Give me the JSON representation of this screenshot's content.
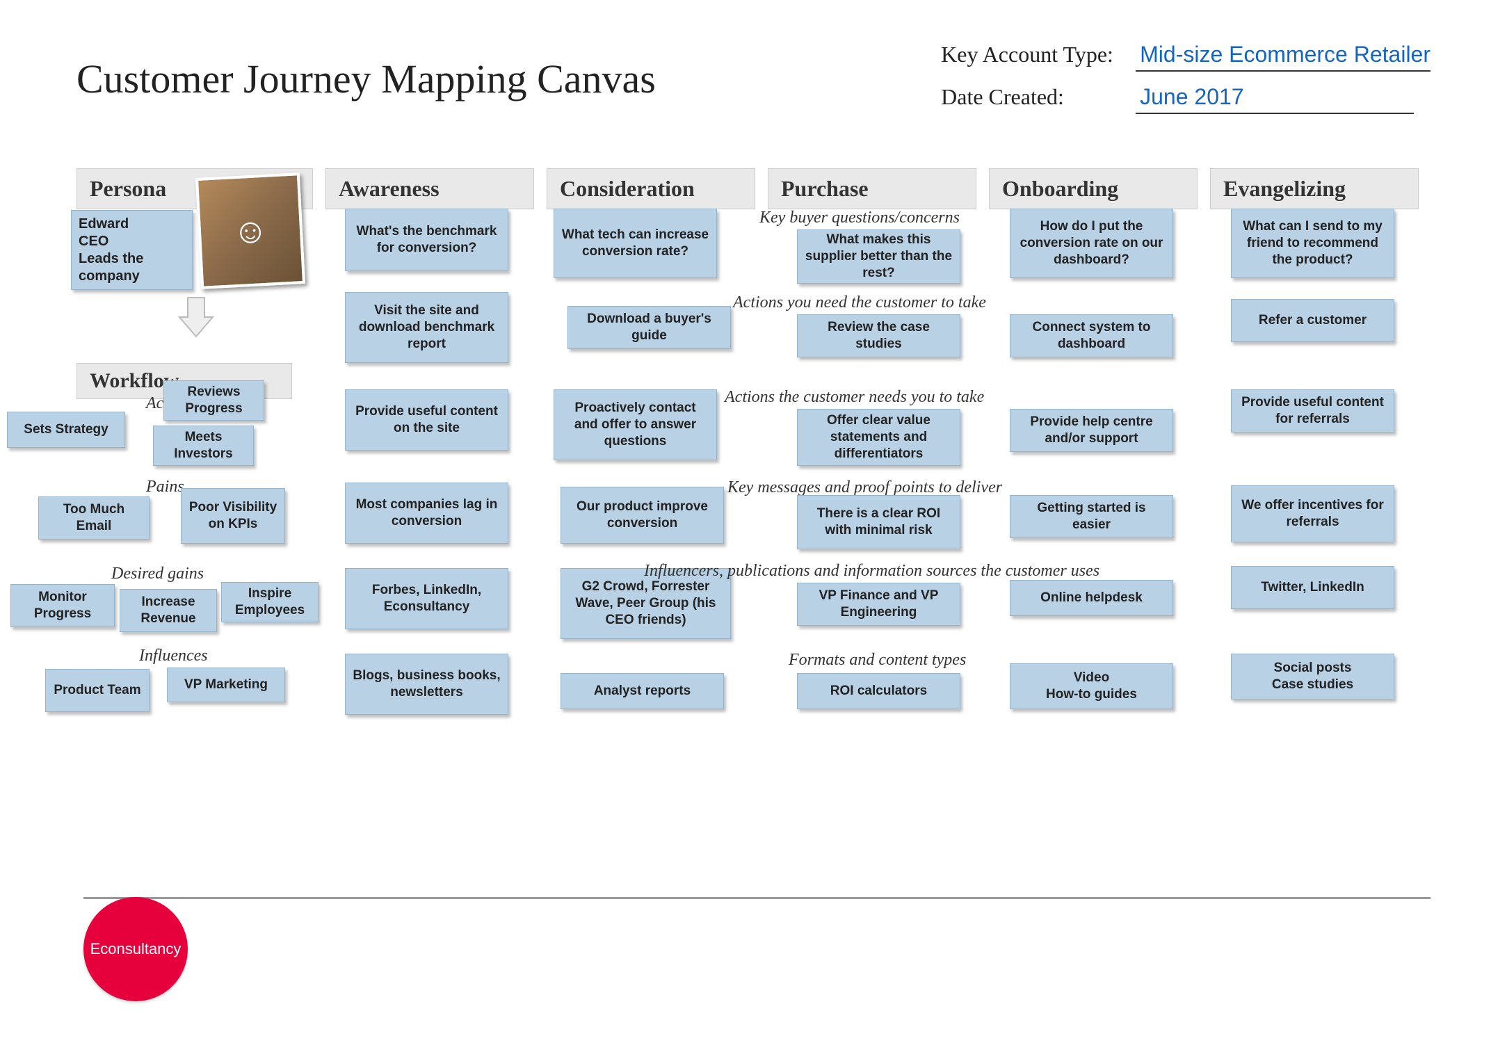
{
  "title": "Customer Journey Mapping Canvas",
  "meta": {
    "account_type_label": "Key Account Type:",
    "account_type_value": "Mid-size Ecommerce Retailer",
    "date_label": "Date Created:",
    "date_value": "June 2017"
  },
  "columns": {
    "persona": "Persona",
    "awareness": "Awareness",
    "consideration": "Consideration",
    "purchase": "Purchase",
    "onboarding": "Onboarding",
    "evangelizing": "Evangelizing"
  },
  "persona": {
    "card": "Edward\nCEO\nLeads the company",
    "workflow_header": "Workflow",
    "activities_label": "Activities",
    "activities": {
      "sets_strategy": "Sets Strategy",
      "reviews_progress": "Reviews Progress",
      "meets_investors": "Meets Investors"
    },
    "pains_label": "Pains",
    "pains": {
      "too_much_email": "Too Much Email",
      "poor_visibility": "Poor Visibility on KPIs"
    },
    "gains_label": "Desired gains",
    "gains": {
      "monitor_progress": "Monitor Progress",
      "increase_revenue": "Increase Revenue",
      "inspire_employees": "Inspire Employees"
    },
    "influences_label": "Influences",
    "influences": {
      "product_team": "Product Team",
      "vp_marketing": "VP Marketing"
    }
  },
  "rows": {
    "buyer_q": "Key buyer questions/concerns",
    "actions_customer": "Actions you need the customer to take",
    "actions_you": "Actions the customer needs you to take",
    "key_messages": "Key messages and proof points to deliver",
    "influencers": "Influencers, publications and information sources the customer uses",
    "formats": "Formats and content types"
  },
  "cells": {
    "awareness": {
      "buyer_q": "What's the benchmark for conversion?",
      "actions_customer": "Visit the site and download benchmark report",
      "actions_you": "Provide useful content on the site",
      "key_messages": "Most companies lag in conversion",
      "influencers": "Forbes, LinkedIn, Econsultancy",
      "formats": "Blogs, business books, newsletters"
    },
    "consideration": {
      "buyer_q": "What tech can increase conversion rate?",
      "actions_customer": "Download a buyer's guide",
      "actions_you": "Proactively contact and offer to answer questions",
      "key_messages": "Our product improve conversion",
      "influencers": "G2 Crowd, Forrester Wave, Peer Group (his CEO friends)",
      "formats": "Analyst reports"
    },
    "purchase": {
      "buyer_q": "What makes this supplier better than the rest?",
      "actions_customer": "Review the case studies",
      "actions_you": "Offer clear value statements and differentiators",
      "key_messages": "There is a clear ROI with minimal risk",
      "influencers": "VP Finance and VP Engineering",
      "formats": "ROI calculators"
    },
    "onboarding": {
      "buyer_q": "How do I put the conversion rate on our dashboard?",
      "actions_customer": "Connect system to dashboard",
      "actions_you": "Provide help centre and/or support",
      "key_messages": "Getting started is easier",
      "influencers": "Online helpdesk",
      "formats": "Video\nHow-to guides"
    },
    "evangelizing": {
      "buyer_q": "What can I send to my friend to recommend the product?",
      "actions_customer": "Refer a customer",
      "actions_you": "Provide useful content for referrals",
      "key_messages": "We offer incentives for referrals",
      "influencers": "Twitter, LinkedIn",
      "formats": "Social posts\nCase studies"
    }
  },
  "logo": "Econsultancy"
}
